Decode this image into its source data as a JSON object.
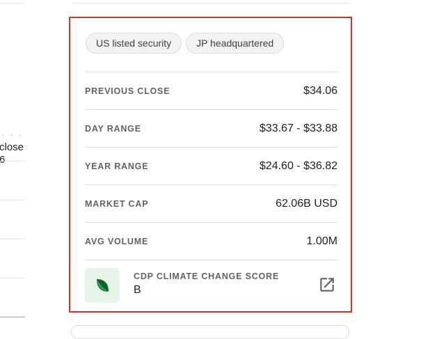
{
  "left_column": {
    "dots": ". . . .",
    "line1": "close",
    "line2": "6"
  },
  "chips": [
    {
      "label": "US listed security"
    },
    {
      "label": "JP headquartered"
    }
  ],
  "stats": [
    {
      "label": "PREVIOUS CLOSE",
      "value": "$34.06"
    },
    {
      "label": "DAY RANGE",
      "value": "$33.67 - $33.88"
    },
    {
      "label": "YEAR RANGE",
      "value": "$24.60 - $36.82"
    },
    {
      "label": "MARKET CAP",
      "value": "62.06B USD"
    },
    {
      "label": "AVG VOLUME",
      "value": "1.00M"
    }
  ],
  "cdp": {
    "label": "CDP CLIMATE CHANGE SCORE",
    "value": "B",
    "icon": "leaf-icon",
    "link_icon": "open-in-new-icon"
  },
  "colors": {
    "highlight_border": "#d93025",
    "leaf_bg": "#e6f4ea",
    "leaf_dark": "#0d652d",
    "leaf_light": "#34a853"
  }
}
